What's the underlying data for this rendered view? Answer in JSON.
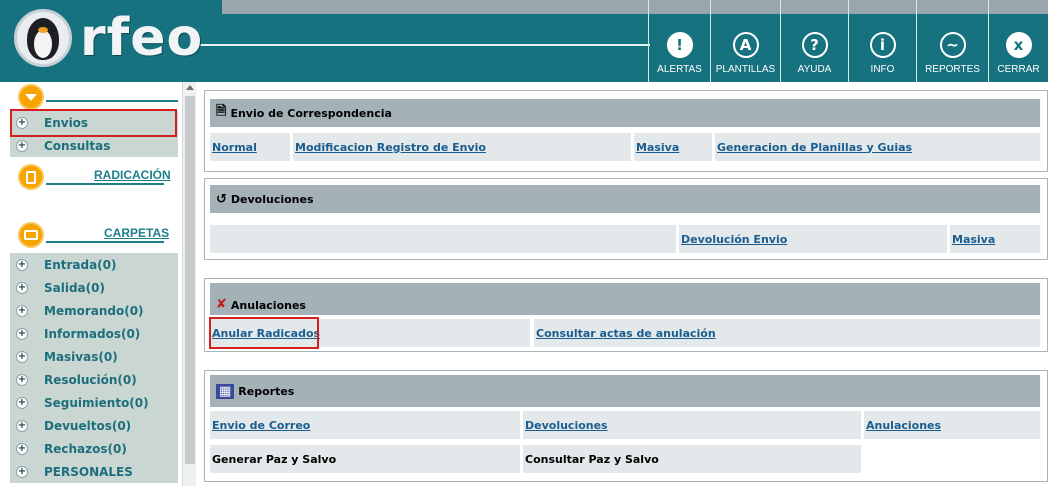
{
  "app": {
    "brand": "rfeo"
  },
  "header": {
    "nav": [
      {
        "label": "ALERTAS",
        "icon": "!",
        "icon_name": "alert-icon"
      },
      {
        "label": "PLANTILLAS",
        "icon": "A",
        "icon_name": "template-icon"
      },
      {
        "label": "AYUDA",
        "icon": "?",
        "icon_name": "help-icon"
      },
      {
        "label": "INFO",
        "icon": "i",
        "icon_name": "info-icon"
      },
      {
        "label": "REPORTES",
        "icon": "~",
        "icon_name": "reports-icon"
      },
      {
        "label": "CERRAR",
        "icon": "x",
        "icon_name": "close-icon"
      }
    ]
  },
  "sidebar": {
    "top_items": [
      {
        "label": "Envios"
      },
      {
        "label": "Consultas"
      }
    ],
    "radicacion_title": "RADICACIÓN",
    "carpetas_title": "CARPETAS",
    "folders": [
      {
        "label": "Entrada(0)"
      },
      {
        "label": "Salida(0)"
      },
      {
        "label": "Memorando(0)"
      },
      {
        "label": "Informados(0)"
      },
      {
        "label": "Masivas(0)"
      },
      {
        "label": "Resolución(0)"
      },
      {
        "label": "Seguimiento(0)"
      },
      {
        "label": "Devueltos(0)"
      },
      {
        "label": "Rechazos(0)"
      },
      {
        "label": "PERSONALES"
      }
    ]
  },
  "sections": {
    "envio": {
      "title": "Envio de Correspondencia",
      "links": [
        "Normal",
        "Modificacion Registro de Envio",
        "Masiva",
        "Generacion de Planillas y Guias"
      ]
    },
    "devoluciones": {
      "title": "Devoluciones",
      "links": [
        "Devolución Envio",
        "Masiva"
      ]
    },
    "anulaciones": {
      "title": "Anulaciones",
      "links": [
        "Anular Radicados",
        "Consultar actas de anulación"
      ]
    },
    "reportes": {
      "title": "Reportes",
      "links": [
        "Envio de Correo",
        "Devoluciones",
        "Anulaciones"
      ],
      "plain": [
        "Generar Paz y Salvo",
        "Consultar Paz y Salvo"
      ]
    }
  },
  "colors": {
    "header_bg": "#16727f",
    "sidebar_item_bg": "#c9d6d1",
    "section_head_bg": "#a4b2b7",
    "cell_bg": "#e3e8ea",
    "link": "#1a5d8e",
    "highlight": "#d3201f",
    "accent_orange": "#f7a300"
  }
}
